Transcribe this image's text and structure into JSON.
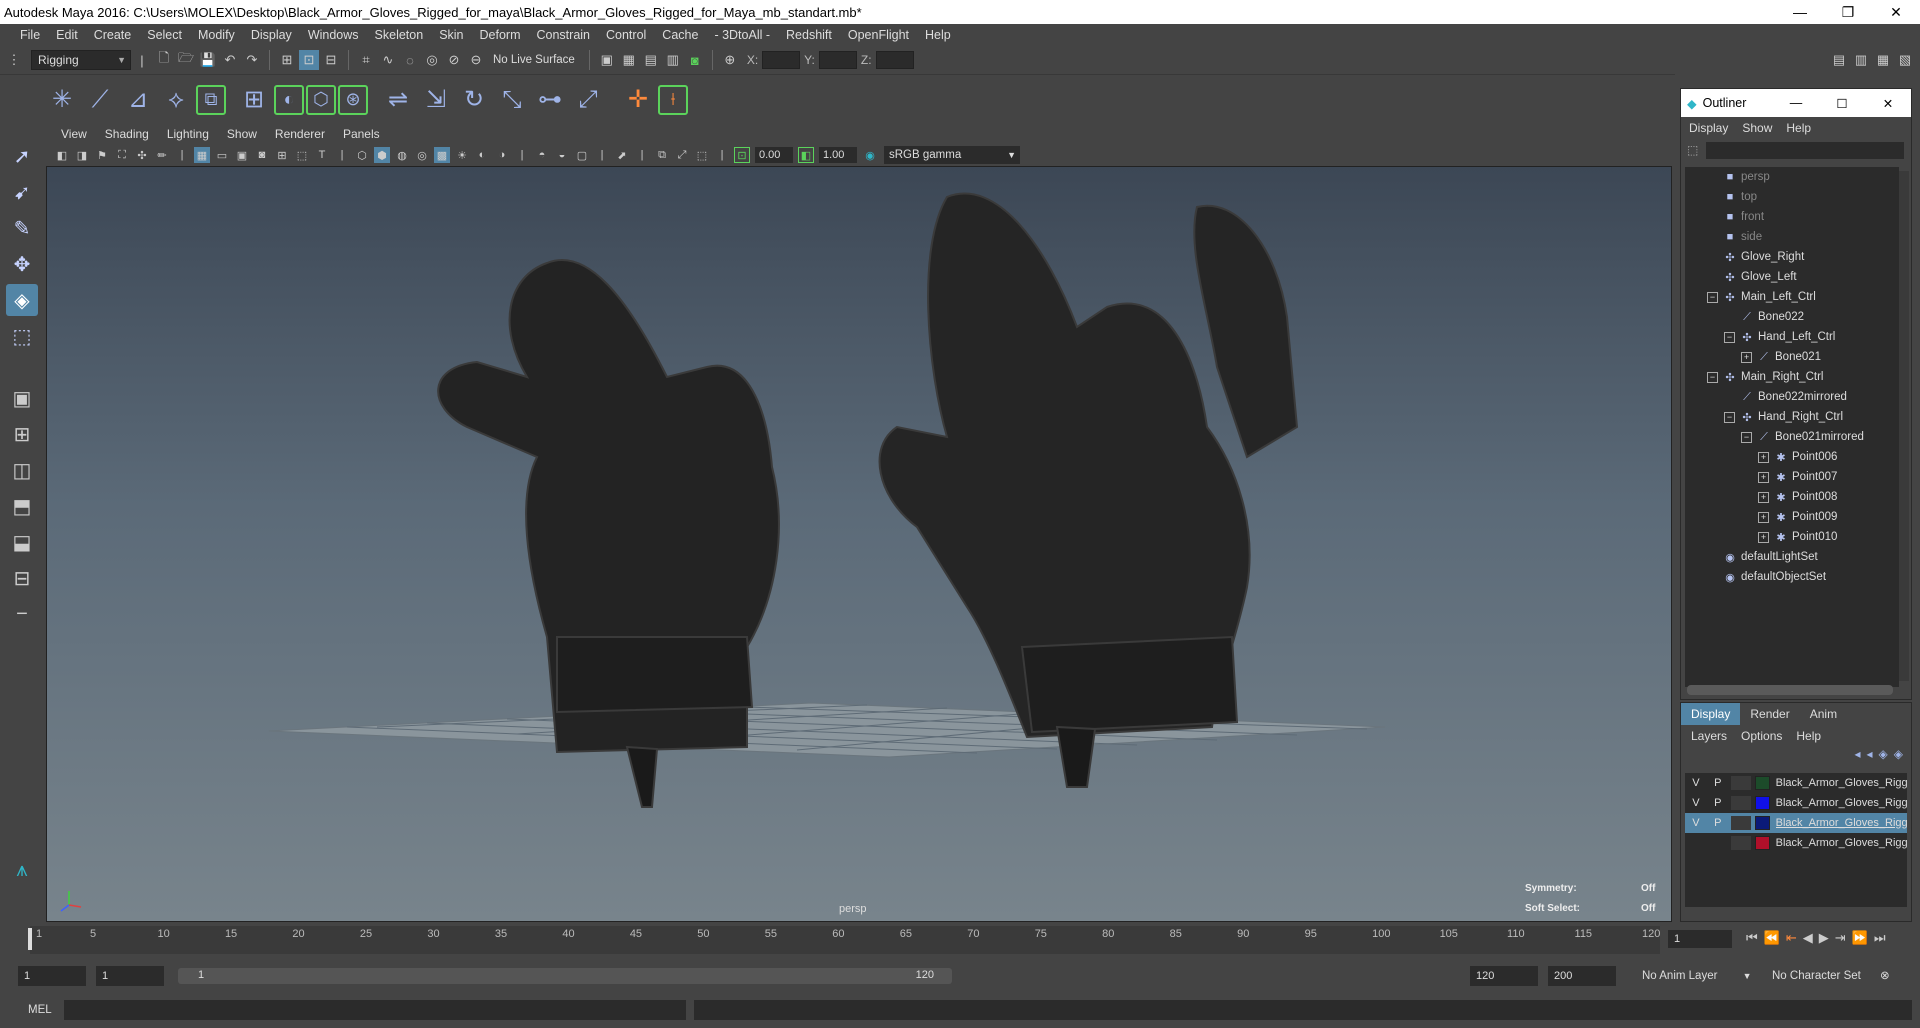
{
  "window": {
    "title": "Autodesk Maya 2016: C:\\Users\\MOLEX\\Desktop\\Black_Armor_Gloves_Rigged_for_maya\\Black_Armor_Gloves_Rigged_for_Maya_mb_standart.mb*",
    "minimize": "—",
    "maximize": "❐",
    "close": "✕"
  },
  "menubar": [
    "File",
    "Edit",
    "Create",
    "Select",
    "Modify",
    "Display",
    "Windows",
    "Skeleton",
    "Skin",
    "Deform",
    "Constrain",
    "Control",
    "Cache",
    "- 3DtoAll -",
    "Redshift",
    "OpenFlight",
    "Help"
  ],
  "statusline": {
    "menuset": "Rigging",
    "live_surface": "No Live Surface",
    "x_label": "X:",
    "y_label": "Y:",
    "z_label": "Z:"
  },
  "viewport": {
    "menus": [
      "View",
      "Shading",
      "Lighting",
      "Show",
      "Renderer",
      "Panels"
    ],
    "near_clip": "0.00",
    "exposure": "1.00",
    "color_space": "sRGB gamma",
    "camera": "persp",
    "symmetry_label": "Symmetry:",
    "symmetry_value": "Off",
    "soft_select_label": "Soft Select:",
    "soft_select_value": "Off"
  },
  "outliner": {
    "title": "Outliner",
    "menus": [
      "Display",
      "Show",
      "Help"
    ],
    "items": [
      {
        "label": "persp",
        "depth": 0,
        "icon": "camera-icon",
        "exp": "",
        "dim": true
      },
      {
        "label": "top",
        "depth": 0,
        "icon": "camera-icon",
        "exp": "",
        "dim": true
      },
      {
        "label": "front",
        "depth": 0,
        "icon": "camera-icon",
        "exp": "",
        "dim": true
      },
      {
        "label": "side",
        "depth": 0,
        "icon": "camera-icon",
        "exp": "",
        "dim": true
      },
      {
        "label": "Glove_Right",
        "depth": 0,
        "icon": "transform-icon",
        "exp": ""
      },
      {
        "label": "Glove_Left",
        "depth": 0,
        "icon": "transform-icon",
        "exp": ""
      },
      {
        "label": "Main_Left_Ctrl",
        "depth": 0,
        "icon": "transform-icon",
        "exp": "−"
      },
      {
        "label": "Bone022",
        "depth": 1,
        "icon": "joint-icon",
        "exp": ""
      },
      {
        "label": "Hand_Left_Ctrl",
        "depth": 1,
        "icon": "transform-icon",
        "exp": "−"
      },
      {
        "label": "Bone021",
        "depth": 2,
        "icon": "joint-icon",
        "exp": "+"
      },
      {
        "label": "Main_Right_Ctrl",
        "depth": 0,
        "icon": "transform-icon",
        "exp": "−"
      },
      {
        "label": "Bone022mirrored",
        "depth": 1,
        "icon": "joint-icon",
        "exp": ""
      },
      {
        "label": "Hand_Right_Ctrl",
        "depth": 1,
        "icon": "transform-icon",
        "exp": "−"
      },
      {
        "label": "Bone021mirrored",
        "depth": 2,
        "icon": "joint-icon",
        "exp": "−"
      },
      {
        "label": "Point006",
        "depth": 3,
        "icon": "point-icon",
        "exp": "+"
      },
      {
        "label": "Point007",
        "depth": 3,
        "icon": "point-icon",
        "exp": "+"
      },
      {
        "label": "Point008",
        "depth": 3,
        "icon": "point-icon",
        "exp": "+"
      },
      {
        "label": "Point009",
        "depth": 3,
        "icon": "point-icon",
        "exp": "+"
      },
      {
        "label": "Point010",
        "depth": 3,
        "icon": "point-icon",
        "exp": "+"
      },
      {
        "label": "defaultLightSet",
        "depth": 0,
        "icon": "set-icon",
        "exp": ""
      },
      {
        "label": "defaultObjectSet",
        "depth": 0,
        "icon": "set-icon",
        "exp": ""
      }
    ]
  },
  "layers": {
    "tabs": [
      "Display",
      "Render",
      "Anim"
    ],
    "menus": [
      "Layers",
      "Options",
      "Help"
    ],
    "rows": [
      {
        "v": "V",
        "p": "P",
        "color": "#1c4b2a",
        "name": "Black_Armor_Gloves_Rigg",
        "selected": false
      },
      {
        "v": "V",
        "p": "P",
        "color": "#1010e8",
        "name": "Black_Armor_Gloves_Rigg",
        "selected": false
      },
      {
        "v": "V",
        "p": "P",
        "color": "#0b1a78",
        "name": "Black_Armor_Gloves_Rigg",
        "selected": true
      },
      {
        "v": "",
        "p": "",
        "color": "#b0102a",
        "name": "Black_Armor_Gloves_Rigg",
        "selected": false
      }
    ]
  },
  "timeline": {
    "ticks": [
      "1",
      "5",
      "10",
      "15",
      "20",
      "25",
      "30",
      "35",
      "40",
      "45",
      "50",
      "55",
      "60",
      "65",
      "70",
      "75",
      "80",
      "85",
      "90",
      "95",
      "100",
      "105",
      "110",
      "115",
      "120"
    ],
    "min": 1,
    "max": 120,
    "current_frame": "1"
  },
  "range": {
    "start": "1",
    "playback_start": "1",
    "range_start": "1",
    "range_end": "120",
    "playback_end": "120",
    "end": "200",
    "anim_layer": "No Anim Layer",
    "character_set": "No Character Set"
  },
  "cmdline": {
    "label": "MEL"
  }
}
